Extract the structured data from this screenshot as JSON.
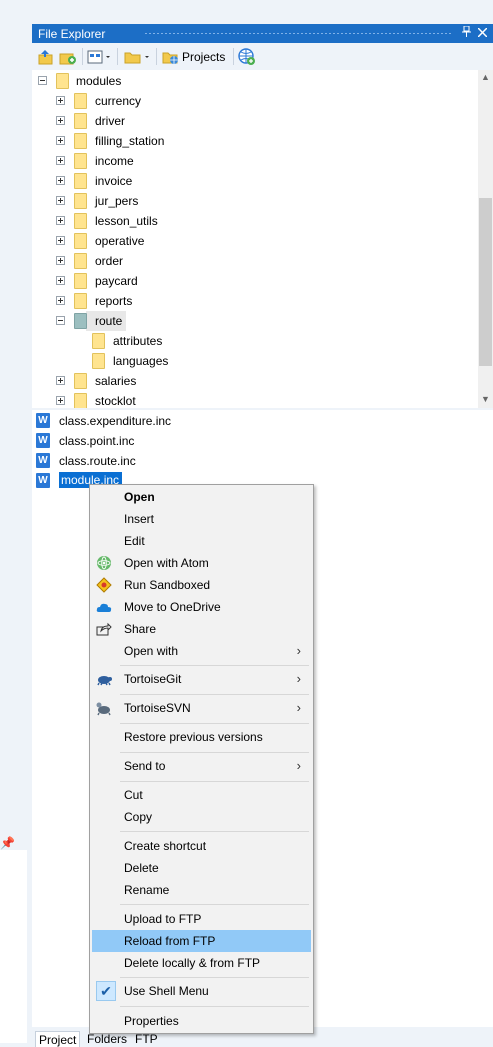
{
  "panel": {
    "title": "File Explorer",
    "pin_glyph": "1",
    "close_glyph": "×"
  },
  "toolbar": {
    "projects_label": "Projects"
  },
  "tree": {
    "root": "modules",
    "items": [
      {
        "label": "currency"
      },
      {
        "label": "driver"
      },
      {
        "label": "filling_station"
      },
      {
        "label": "income"
      },
      {
        "label": "invoice"
      },
      {
        "label": "jur_pers"
      },
      {
        "label": "lesson_utils"
      },
      {
        "label": "operative"
      },
      {
        "label": "order"
      },
      {
        "label": "paycard"
      },
      {
        "label": "reports"
      },
      {
        "label": "route"
      },
      {
        "label": "attributes"
      },
      {
        "label": "languages"
      },
      {
        "label": "salaries"
      },
      {
        "label": "stocklot"
      }
    ]
  },
  "files": [
    {
      "name": "class.expenditure.inc"
    },
    {
      "name": "class.point.inc"
    },
    {
      "name": "class.route.inc"
    },
    {
      "name": "module.inc"
    }
  ],
  "file_icon_letter": "W",
  "context_menu": {
    "items": [
      {
        "label": "Open"
      },
      {
        "label": "Insert"
      },
      {
        "label": "Edit"
      },
      {
        "label": "Open with Atom"
      },
      {
        "label": "Run Sandboxed"
      },
      {
        "label": "Move to OneDrive"
      },
      {
        "label": "Share"
      },
      {
        "label": "Open with"
      },
      {
        "label": "TortoiseGit"
      },
      {
        "label": "TortoiseSVN"
      },
      {
        "label": "Restore previous versions"
      },
      {
        "label": "Send to"
      },
      {
        "label": "Cut"
      },
      {
        "label": "Copy"
      },
      {
        "label": "Create shortcut"
      },
      {
        "label": "Delete"
      },
      {
        "label": "Rename"
      },
      {
        "label": "Upload to FTP"
      },
      {
        "label": "Reload from FTP"
      },
      {
        "label": "Delete locally & from FTP"
      },
      {
        "label": "Use Shell Menu"
      },
      {
        "label": "Properties"
      }
    ],
    "submenu_arrow": "›",
    "check_glyph": "✔"
  },
  "tabs": [
    {
      "label": "Project"
    },
    {
      "label": "Folders"
    },
    {
      "label": "FTP"
    }
  ],
  "colors": {
    "title_bar": "#1c6ec6",
    "selection": "#0a6fd3",
    "menu_hover": "#91c9f7",
    "folder": "#ffe48f"
  }
}
